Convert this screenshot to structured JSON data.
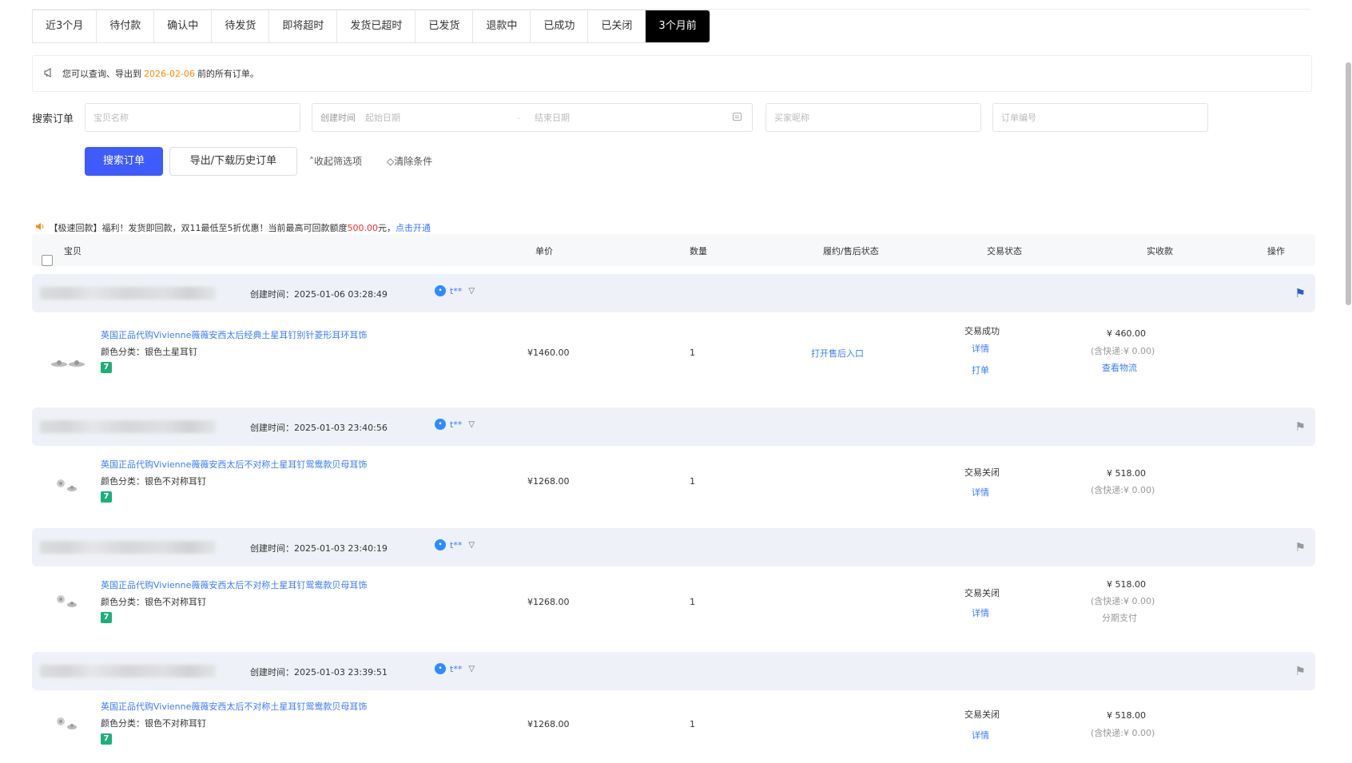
{
  "tabs": [
    {
      "label": "近3个月",
      "active": false
    },
    {
      "label": "待付款",
      "active": false
    },
    {
      "label": "确认中",
      "active": false
    },
    {
      "label": "待发货",
      "active": false
    },
    {
      "label": "即将超时",
      "active": false
    },
    {
      "label": "发货已超时",
      "active": false
    },
    {
      "label": "已发货",
      "active": false
    },
    {
      "label": "退款中",
      "active": false
    },
    {
      "label": "已成功",
      "active": false
    },
    {
      "label": "已关闭",
      "active": false
    },
    {
      "label": "3个月前",
      "active": true
    }
  ],
  "notice": {
    "prefix": "您可以查询、导出到",
    "date": "2026-02-06",
    "suffix": "前的所有订单。"
  },
  "search": {
    "label": "搜索订单",
    "item_placeholder": "宝贝名称",
    "created_label": "创建时间",
    "start_placeholder": "起始日期",
    "dash": "-",
    "end_placeholder": "结束日期",
    "buyer_placeholder": "买家昵称",
    "order_placeholder": "订单编号",
    "search_button": "搜索订单",
    "export_button": "导出/下载历史订单",
    "collapse_link": "收起筛选项",
    "clear_link": "清除条件"
  },
  "promo": {
    "part1": "【极速回款】福利！发货即回款，双11最低至5折优惠！当前最高可回款额度",
    "amount": "500.00",
    "part2": "元，",
    "link": "点击开通"
  },
  "table_header": {
    "item": "宝贝",
    "unit_price": "单价",
    "quantity": "数量",
    "fulfillment": "履约/售后状态",
    "trade_status": "交易状态",
    "received": "实收款",
    "actions": "操作"
  },
  "orders": [
    {
      "created": "创建时间：2025-01-06 03:28:49",
      "buyer": "t**",
      "title": "英国正品代购Vivienne薇薇安西太后经典土星耳钉别针菱形耳环耳饰",
      "sku": "颜色分类：银色土星耳钉",
      "tag": "7",
      "price": "¥1460.00",
      "qty": "1",
      "after_sale": "打开售后入口",
      "status": "交易成功",
      "detail": "详情",
      "print": "打单",
      "amount": "¥ 460.00",
      "shipping": "(含快递:¥ 0.00)",
      "logistics": "查看物流",
      "flagged": true
    },
    {
      "created": "创建时间：2025-01-03 23:40:56",
      "buyer": "t**",
      "title": "英国正品代购Vivienne薇薇安西太后不对称土星耳钉鸳鸯款贝母耳饰",
      "sku": "颜色分类：银色不对称耳钉",
      "tag": "7",
      "price": "¥1268.00",
      "qty": "1",
      "status": "交易关闭",
      "detail": "详情",
      "amount": "¥ 518.00",
      "shipping": "(含快递:¥ 0.00)",
      "flagged": false
    },
    {
      "created": "创建时间：2025-01-03 23:40:19",
      "buyer": "t**",
      "title": "英国正品代购Vivienne薇薇安西太后不对称土星耳钉鸳鸯款贝母耳饰",
      "sku": "颜色分类：银色不对称耳钉",
      "tag": "7",
      "price": "¥1268.00",
      "qty": "1",
      "status": "交易关闭",
      "detail": "详情",
      "amount": "¥ 518.00",
      "shipping": "(含快递:¥ 0.00)",
      "installment": "分期支付",
      "flagged": false
    },
    {
      "created": "创建时间：2025-01-03 23:39:51",
      "buyer": "t**",
      "title": "英国正品代购Vivienne薇薇安西太后不对称土星耳钉鸳鸯款贝母耳饰",
      "sku": "颜色分类：银色不对称耳钉",
      "tag": "7",
      "price": "¥1268.00",
      "qty": "1",
      "status": "交易关闭",
      "detail": "详情",
      "amount": "¥ 518.00",
      "shipping": "(含快递:¥ 0.00)",
      "flagged": false
    }
  ],
  "icons": {
    "notice": "megaphone-icon",
    "calendar": "calendar-icon",
    "speaker": "speaker-icon",
    "flag": "flag-icon",
    "chat": "wangwang-icon",
    "filter": "filter-icon"
  },
  "colors": {
    "primary": "#3e5bff",
    "link": "#3a7bff",
    "accent": "#ff8a00",
    "red": "#ff2a2a",
    "flag_active": "#2a5bd7",
    "tag_green": "#1bb07a"
  }
}
